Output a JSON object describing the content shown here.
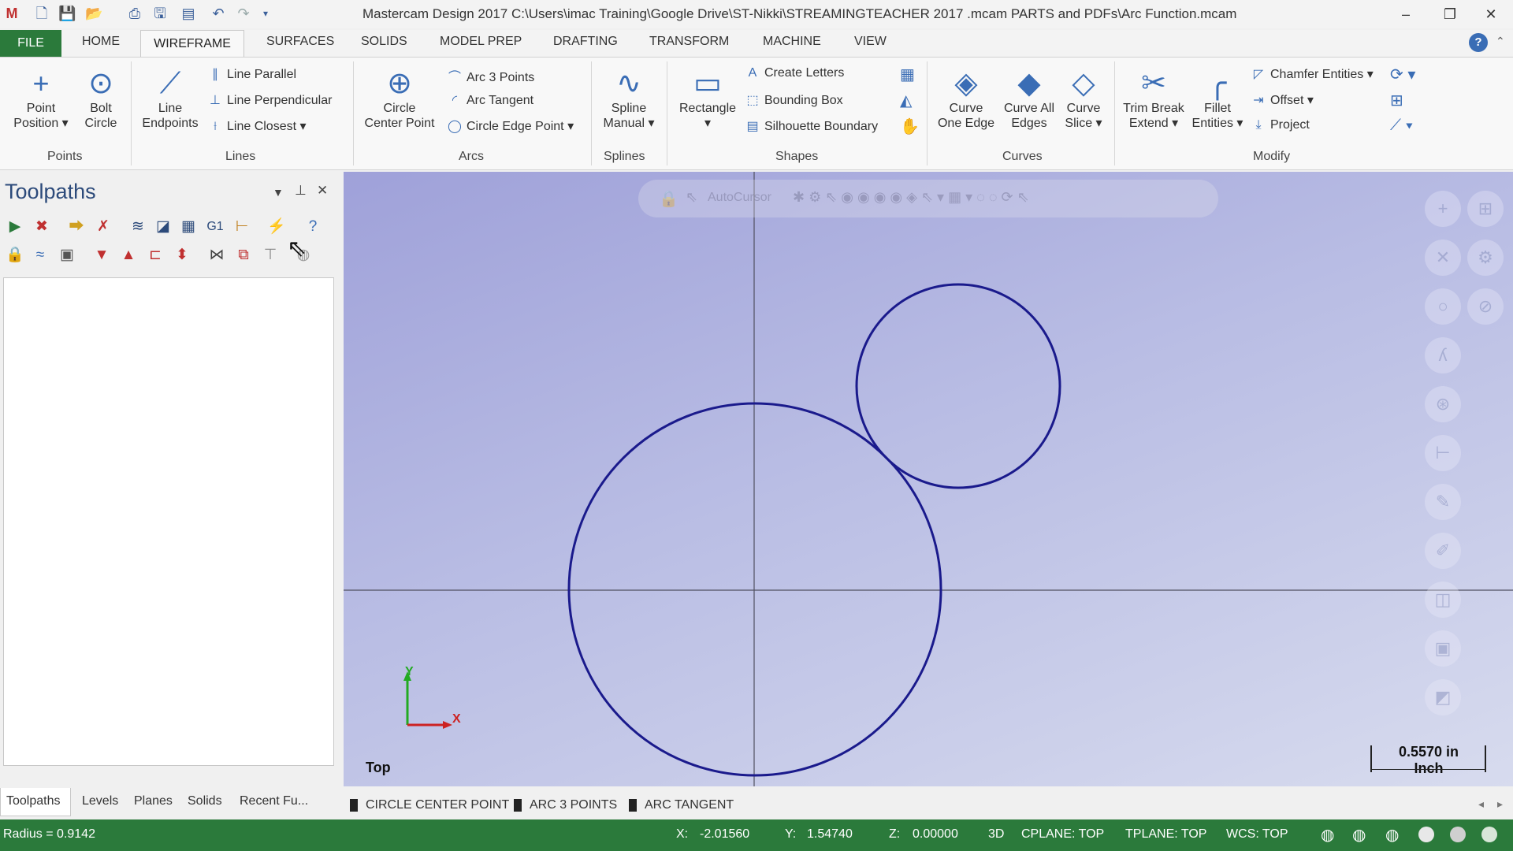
{
  "app": {
    "title": "Mastercam Design 2017  C:\\Users\\imac Training\\Google Drive\\ST-Nikki\\STREAMINGTEACHER 2017 .mcam PARTS and PDFs\\Arc Function.mcam",
    "window_controls": {
      "minimize": "–",
      "restore": "❐",
      "close": "✕"
    }
  },
  "menu": {
    "file": "FILE",
    "tabs": [
      "HOME",
      "WIREFRAME",
      "SURFACES",
      "SOLIDS",
      "MODEL PREP",
      "DRAFTING",
      "TRANSFORM",
      "MACHINE",
      "VIEW"
    ],
    "active_tab": "WIREFRAME"
  },
  "ribbon": {
    "points": {
      "group": "Points",
      "point_position": [
        "Point",
        "Position ▾"
      ],
      "bolt_circle": [
        "Bolt",
        "Circle"
      ]
    },
    "lines": {
      "group": "Lines",
      "line_endpoints": [
        "Line",
        "Endpoints"
      ],
      "line_parallel": "Line Parallel",
      "line_perpendicular": "Line Perpendicular",
      "line_closest": "Line Closest ▾"
    },
    "arcs": {
      "group": "Arcs",
      "circle_center_point": [
        "Circle",
        "Center Point"
      ],
      "arc_3_points": "Arc 3 Points",
      "arc_tangent": "Arc Tangent",
      "circle_edge_point": "Circle Edge Point ▾"
    },
    "splines": {
      "group": "Splines",
      "spline_manual": [
        "Spline",
        "Manual ▾"
      ]
    },
    "shapes": {
      "group": "Shapes",
      "rectangle": [
        "Rectangle",
        "▾"
      ],
      "create_letters": "Create Letters",
      "bounding_box": "Bounding Box",
      "silhouette_boundary": "Silhouette Boundary"
    },
    "curves": {
      "group": "Curves",
      "curve_one_edge": [
        "Curve",
        "One Edge"
      ],
      "curve_all_edges": [
        "Curve All",
        "Edges"
      ],
      "curve_slice": [
        "Curve",
        "Slice ▾"
      ]
    },
    "modify": {
      "group": "Modify",
      "trim_break_extend": [
        "Trim Break",
        "Extend ▾"
      ],
      "fillet_entities": [
        "Fillet",
        "Entities ▾"
      ],
      "chamfer_entities": "Chamfer Entities ▾",
      "offset": "Offset ▾",
      "project": "Project"
    }
  },
  "toolpaths_panel": {
    "title": "Toolpaths",
    "bottom_tabs": [
      "Toolpaths",
      "Levels",
      "Planes",
      "Solids",
      "Recent Fu..."
    ]
  },
  "viewport": {
    "autocursor": "AutoCursor",
    "view_label": "Top",
    "axis_x": "X",
    "axis_y": "Y",
    "scale_value": "0.5570 in",
    "scale_unit": "Inch",
    "function_tabs": [
      "CIRCLE CENTER POINT",
      "ARC 3 POINTS",
      "ARC TANGENT"
    ]
  },
  "status": {
    "radius": "Radius = 0.9142",
    "x_label": "X:",
    "x_value": "-2.01560",
    "y_label": "Y:",
    "y_value": "1.54740",
    "z_label": "Z:",
    "z_value": "0.00000",
    "mode": "3D",
    "cplane": "CPLANE: TOP",
    "tplane": "TPLANE: TOP",
    "wcs": "WCS: TOP"
  },
  "colors": {
    "accent_green": "#2b7a3b",
    "geometry": "#1a1a8c",
    "axis_x": "#cc2222",
    "axis_y": "#22aa22"
  }
}
